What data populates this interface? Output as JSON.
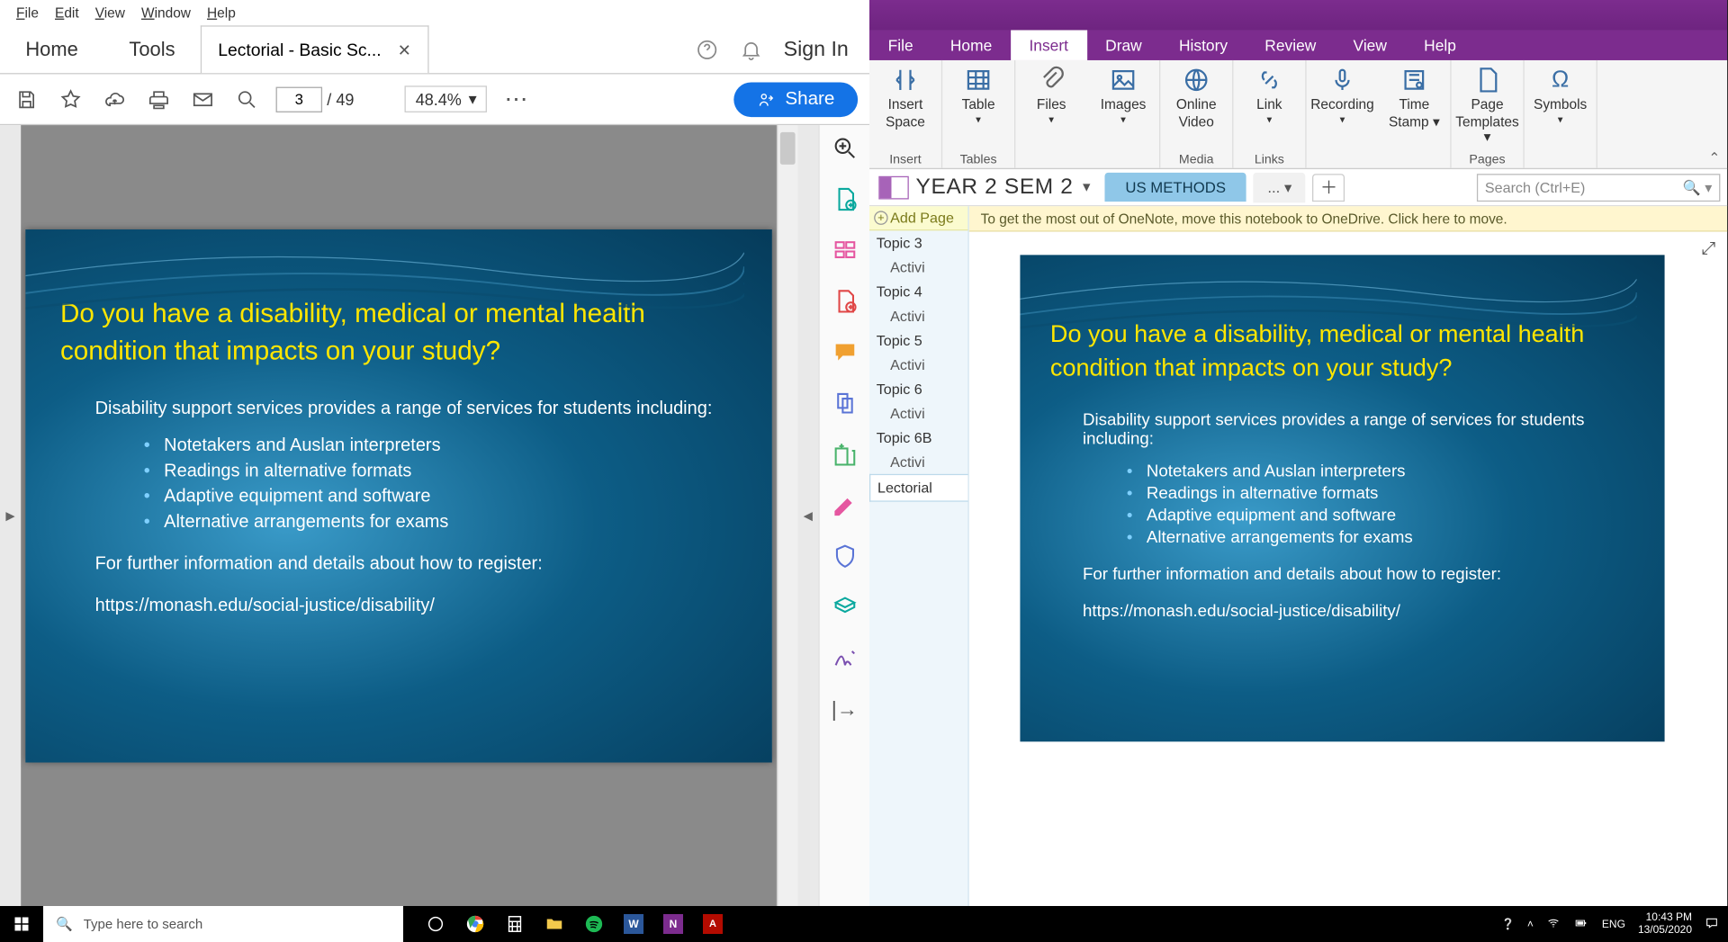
{
  "acrobat": {
    "menubar": [
      "File",
      "Edit",
      "View",
      "Window",
      "Help"
    ],
    "home": "Home",
    "tools": "Tools",
    "doc_tab": "Lectorial - Basic Sc...",
    "sign_in": "Sign In",
    "page_current": "3",
    "page_sep": "/",
    "page_total": "49",
    "zoom": "48.4%",
    "share": "Share"
  },
  "slide": {
    "title": "Do you have a disability, medical or mental health condition that impacts on your study?",
    "intro": "Disability support services provides a range of services for students including:",
    "bullets": [
      "Notetakers and Auslan interpreters",
      "Readings in alternative formats",
      "Adaptive equipment and software",
      "Alternative arrangements for exams"
    ],
    "more_info": "For further information and details about how to register:",
    "url": "https://monash.edu/social-justice/disability/"
  },
  "onenote": {
    "menus": [
      "File",
      "Home",
      "Insert",
      "Draw",
      "History",
      "Review",
      "View",
      "Help"
    ],
    "active_menu": "Insert",
    "ribbon": {
      "groups": [
        {
          "label": "Insert",
          "items": [
            {
              "ic": "space",
              "t1": "Insert",
              "t2": "Space"
            }
          ]
        },
        {
          "label": "Tables",
          "items": [
            {
              "ic": "table",
              "t1": "Table",
              "dd": true
            }
          ]
        },
        {
          "label": "",
          "items": [
            {
              "ic": "clip",
              "t1": "Files",
              "dd": true
            },
            {
              "ic": "img",
              "t1": "Images",
              "dd": true
            }
          ]
        },
        {
          "label": "Media",
          "items": [
            {
              "ic": "globe",
              "t1": "Online",
              "t2": "Video"
            }
          ]
        },
        {
          "label": "Links",
          "items": [
            {
              "ic": "link",
              "t1": "Link",
              "dd": true
            }
          ]
        },
        {
          "label": "",
          "items": [
            {
              "ic": "mic",
              "t1": "Recording",
              "dd": true
            },
            {
              "ic": "stamp",
              "t1": "Time",
              "t2": "Stamp ▾"
            }
          ]
        },
        {
          "label": "Pages",
          "items": [
            {
              "ic": "page",
              "t1": "Page",
              "t2": "Templates ▾"
            }
          ]
        },
        {
          "label": "",
          "items": [
            {
              "ic": "omega",
              "t1": "Symbols",
              "dd": true
            }
          ]
        }
      ]
    },
    "notebook": "YEAR 2 SEM 2",
    "section": "US METHODS",
    "section_more": "...",
    "search_placeholder": "Search (Ctrl+E)",
    "add_page": "Add Page",
    "info_bar": "To get the most out of OneNote, move this notebook to OneDrive. Click here to move.",
    "pages": [
      {
        "t": "Topic 3"
      },
      {
        "t": "Activi",
        "sub": true
      },
      {
        "t": "Topic 4"
      },
      {
        "t": "Activi",
        "sub": true
      },
      {
        "t": "Topic 5"
      },
      {
        "t": "Activi",
        "sub": true
      },
      {
        "t": "Topic 6"
      },
      {
        "t": "Activi",
        "sub": true
      },
      {
        "t": "Topic 6B"
      },
      {
        "t": "Activi",
        "sub": true
      },
      {
        "t": "Lectorial",
        "sel": true
      }
    ]
  },
  "taskbar": {
    "search_placeholder": "Type here to search",
    "lang": "ENG",
    "time": "10:43 PM",
    "date": "13/05/2020"
  }
}
